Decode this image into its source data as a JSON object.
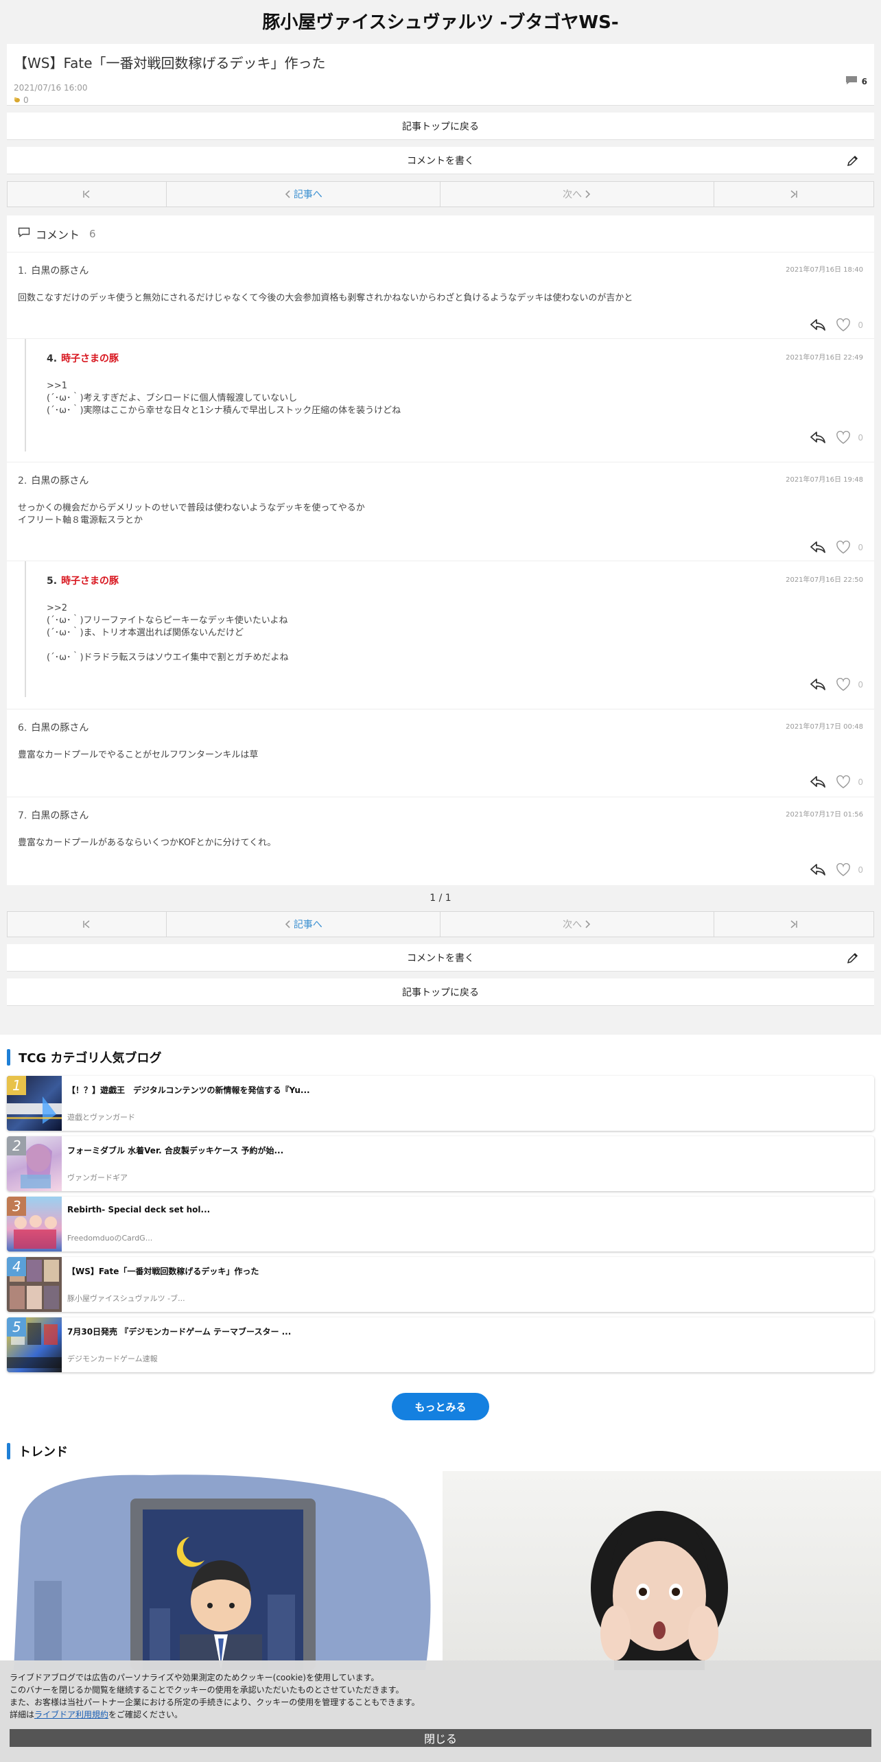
{
  "site": {
    "title": "豚小屋ヴァイスシュヴァルツ -ブタゴヤWS-"
  },
  "article": {
    "title": "【WS】Fate「一番対戦回数稼げるデッキ」作った",
    "date": "2021/07/16 16:00",
    "likes": "0",
    "comment_count": "6"
  },
  "nav": {
    "back_to_top": "記事トップに戻る",
    "write_comment": "コメントを書く",
    "to_article": "記事へ",
    "next": "次へ"
  },
  "comments": {
    "label": "コメント",
    "count": "6",
    "items": [
      {
        "num": "1.",
        "name": "白黒の豚さん",
        "date": "2021年07月16日 18:40",
        "body": "回数こなすだけのデッキ使うと無効にされるだけじゃなくて今後の大会参加資格も剥奪されかねないからわざと負けるようなデッキは使わないのが吉かと",
        "likes": "0"
      },
      {
        "num": "4.",
        "name": "時子さまの豚",
        "date": "2021年07月16日 22:49",
        "body": ">>1\n(´･ω･｀)考えすぎだよ、ブシロードに個人情報渡していないし\n(´･ω･｀)実際はここから幸せな日々と1シナ積んで早出しストック圧縮の体を装うけどね",
        "likes": "0"
      },
      {
        "num": "2.",
        "name": "白黒の豚さん",
        "date": "2021年07月16日 19:48",
        "body": "せっかくの機会だからデメリットのせいで普段は使わないようなデッキを使ってやるか\nイフリート軸８電源転スラとか",
        "likes": "0"
      },
      {
        "num": "5.",
        "name": "時子さまの豚",
        "date": "2021年07月16日 22:50",
        "body": ">>2\n(´･ω･｀)フリーファイトならピーキーなデッキ使いたいよね\n(´･ω･｀)ま、トリオ本選出れば関係ないんだけど\n\n(´･ω･｀)ドラドラ転スラはソウエイ集中で割とガチめだよね",
        "likes": "0"
      },
      {
        "num": "6.",
        "name": "白黒の豚さん",
        "date": "2021年07月17日 00:48",
        "body": "豊富なカードプールでやることがセルフワンターンキルは草",
        "likes": "0"
      },
      {
        "num": "7.",
        "name": "白黒の豚さん",
        "date": "2021年07月17日 01:56",
        "body": "豊富なカードプールがあるならいくつかKOFとかに分けてくれ。",
        "likes": "0"
      }
    ]
  },
  "pagination": {
    "text": "1 / 1"
  },
  "ranking": {
    "title": "TCG カテゴリ人気ブログ",
    "items": [
      {
        "rank": "1",
        "title": "【！？】遊戯王　デジタルコンテンツの新情報を発信する『Yu...",
        "blog": "遊戯とヴァンガード"
      },
      {
        "rank": "2",
        "title": "フォーミダブル 水着Ver. 合皮製デッキケース 予約が始...",
        "blog": "ヴァンガードギア"
      },
      {
        "rank": "3",
        "title": "Rebirth- Special deck set hol...",
        "blog": "FreedomduoのCardG..."
      },
      {
        "rank": "4",
        "title": "【WS】Fate「一番対戦回数稼げるデッキ」作った",
        "blog": "豚小屋ヴァイスシュヴァルツ -ブ..."
      },
      {
        "rank": "5",
        "title": "7月30日発売 『デジモンカードゲーム テーマブースター ...",
        "blog": "デジモンカードゲーム速報"
      }
    ],
    "more": "もっとみる"
  },
  "trend": {
    "title": "トレンド"
  },
  "cookie": {
    "line1": "ライブドアブログでは広告のパーソナライズや効果測定のためクッキー(cookie)を使用しています。",
    "line2": "このバナーを閉じるか閲覧を継続することでクッキーの使用を承認いただいたものとさせていただきます。",
    "line3": "また、お客様は当社パートナー企業における所定の手続きにより、クッキーの使用を管理することもできます。",
    "line4_pre": "詳細は",
    "link": "ライブドア利用規約",
    "line4_post": "をご確認ください。",
    "close": "閉じる"
  },
  "colors": {
    "accent": "#1e7fd6",
    "name_red": "#d8161f",
    "more_button": "#1480e0"
  }
}
